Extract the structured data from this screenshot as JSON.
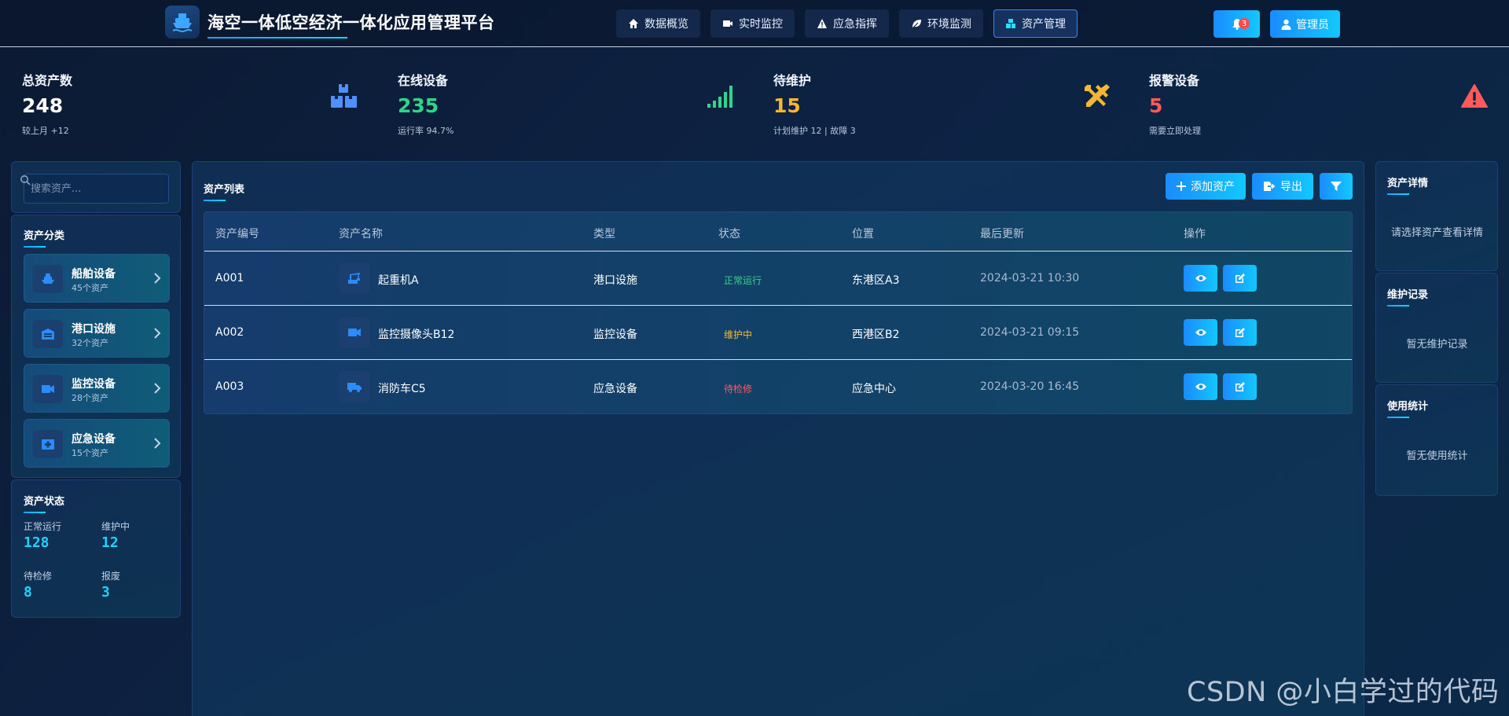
{
  "header": {
    "title": "海空一体低空经济一体化应用管理平台",
    "nav": [
      {
        "label": "数据概览",
        "icon": "home-icon"
      },
      {
        "label": "实时监控",
        "icon": "video-icon"
      },
      {
        "label": "应急指挥",
        "icon": "warning-icon"
      },
      {
        "label": "环境监测",
        "icon": "leaf-icon"
      },
      {
        "label": "资产管理",
        "icon": "boxes-icon",
        "active": true
      }
    ],
    "notification_count": "3",
    "user_label": "管理员"
  },
  "stats": [
    {
      "label": "总资产数",
      "value": "248",
      "sub": "较上月 +12",
      "color": "#ffffff",
      "icon": "boxes-icon",
      "icon_color": "#4f8fff"
    },
    {
      "label": "在线设备",
      "value": "235",
      "sub": "运行率 94.7%",
      "color": "#2fd68a",
      "icon": "signal-icon",
      "icon_color": "#2fd68a"
    },
    {
      "label": "待维护",
      "value": "15",
      "sub": "计划维护 12 | 故障 3",
      "color": "#f7b731",
      "icon": "tools-icon",
      "icon_color": "#f7b731"
    },
    {
      "label": "报警设备",
      "value": "5",
      "sub": "需要立即处理",
      "color": "#ff5a5a",
      "icon": "alert-triangle-icon",
      "icon_color": "#ff5a5a"
    }
  ],
  "sidebar": {
    "search_placeholder": "搜索资产...",
    "category_title": "资产分类",
    "categories": [
      {
        "name": "船舶设备",
        "count": "45个资产",
        "icon": "ship-icon"
      },
      {
        "name": "港口设施",
        "count": "32个资产",
        "icon": "warehouse-icon"
      },
      {
        "name": "监控设备",
        "count": "28个资产",
        "icon": "video-icon"
      },
      {
        "name": "应急设备",
        "count": "15个资产",
        "icon": "first-aid-icon"
      }
    ],
    "status_title": "资产状态",
    "status": [
      {
        "label": "正常运行",
        "value": "128"
      },
      {
        "label": "维护中",
        "value": "12"
      },
      {
        "label": "待检修",
        "value": "8"
      },
      {
        "label": "报废",
        "value": "3"
      }
    ]
  },
  "main": {
    "title": "资产列表",
    "add_label": "添加资产",
    "export_label": "导出",
    "columns": [
      "资产编号",
      "资产名称",
      "类型",
      "状态",
      "位置",
      "最后更新",
      "操作"
    ],
    "rows": [
      {
        "id": "A001",
        "name": "起重机A",
        "type": "港口设施",
        "status": "正常运行",
        "status_color": "#2fd68a",
        "location": "东港区A3",
        "updated": "2024-03-21 10:30",
        "icon": "crane-icon"
      },
      {
        "id": "A002",
        "name": "监控摄像头B12",
        "type": "监控设备",
        "status": "维护中",
        "status_color": "#f7b731",
        "location": "西港区B2",
        "updated": "2024-03-21 09:15",
        "icon": "video-icon"
      },
      {
        "id": "A003",
        "name": "消防车C5",
        "type": "应急设备",
        "status": "待检修",
        "status_color": "#ff5a5a",
        "location": "应急中心",
        "updated": "2024-03-20 16:45",
        "icon": "truck-icon"
      }
    ]
  },
  "right": {
    "detail_title": "资产详情",
    "detail_text": "请选择资产查看详情",
    "maint_title": "维护记录",
    "maint_text": "暂无维护记录",
    "usage_title": "使用统计",
    "usage_text": "暂无使用统计"
  },
  "watermark": "CSDN @小白学过的代码"
}
